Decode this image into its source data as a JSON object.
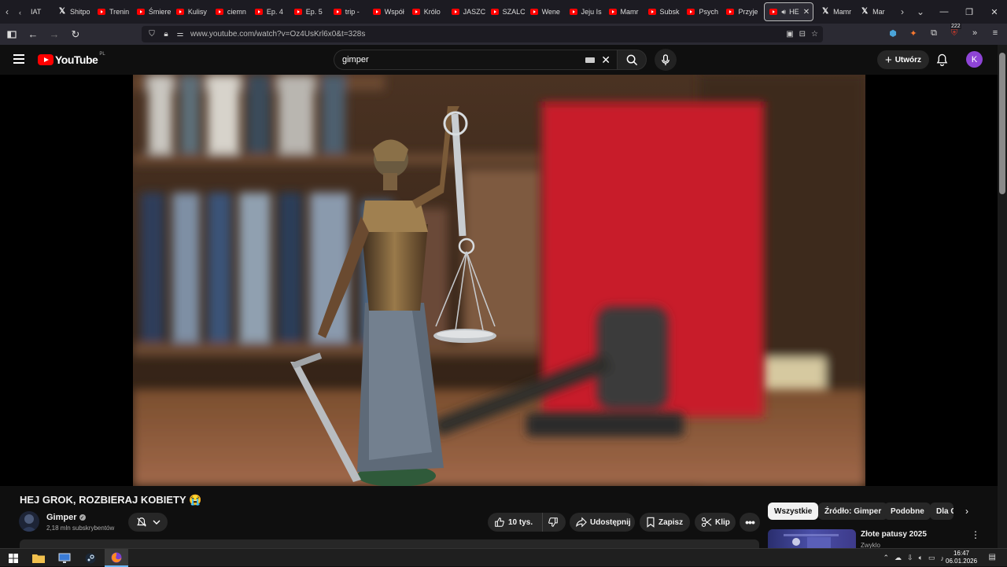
{
  "browser": {
    "tabs": [
      {
        "label": "IAT",
        "favicon": "chevron-left"
      },
      {
        "label": "Shitpo",
        "favicon": "x-logo"
      },
      {
        "label": "Trenin",
        "favicon": "youtube-logo"
      },
      {
        "label": "Śmiere",
        "favicon": "youtube-logo"
      },
      {
        "label": "Kulisy",
        "favicon": "youtube-logo"
      },
      {
        "label": "ciemn",
        "favicon": "youtube-logo"
      },
      {
        "label": "Ep. 4",
        "favicon": "youtube-logo"
      },
      {
        "label": "Ep. 5",
        "favicon": "youtube-logo"
      },
      {
        "label": "trip -",
        "favicon": "youtube-logo"
      },
      {
        "label": "Współ",
        "favicon": "youtube-logo"
      },
      {
        "label": "Królo",
        "favicon": "youtube-logo"
      },
      {
        "label": "JASZC",
        "favicon": "youtube-logo"
      },
      {
        "label": "SZALC",
        "favicon": "youtube-logo"
      },
      {
        "label": "Wene",
        "favicon": "youtube-logo"
      },
      {
        "label": "Jeju Is",
        "favicon": "youtube-logo"
      },
      {
        "label": "Mamr",
        "favicon": "youtube-logo"
      },
      {
        "label": "Subsk",
        "favicon": "youtube-logo"
      },
      {
        "label": "Psych",
        "favicon": "youtube-logo"
      },
      {
        "label": "Przyje",
        "favicon": "youtube-logo"
      },
      {
        "label": "HE",
        "favicon": "youtube-logo",
        "active": true
      },
      {
        "label": "Mamr",
        "favicon": "x-logo"
      },
      {
        "label": "Mar",
        "favicon": "x-logo"
      }
    ],
    "url": "www.youtube.com/watch?v=Oz4UsKrl6x0&t=328s",
    "extension_badge": "222"
  },
  "youtube": {
    "logo_text": "YouTube",
    "country_code": "PL",
    "search_value": "gimper",
    "create_label": "Utwórz",
    "avatar_letter": "K"
  },
  "video": {
    "title": "HEJ GROK, ROZBIERAJ KOBIETY 😭",
    "channel": "Gimper",
    "subscribers": "2,18 mln subskrybentów",
    "likes": "10 tys.",
    "share_label": "Udostępnij",
    "save_label": "Zapisz",
    "clip_label": "Klip"
  },
  "sidebar": {
    "chips": [
      "Wszystkie",
      "Źródło: Gimper",
      "Podobne",
      "Dla Ci"
    ],
    "recommendation": {
      "title": "Złote patusy 2025",
      "subtitle": "Zwyklo"
    }
  },
  "taskbar": {
    "time": "16:47",
    "date": "06.01.2026"
  },
  "colors": {
    "accent_red": "#ff0000",
    "avatar_purple": "#8e44d6",
    "background": "#0f0f0f"
  }
}
